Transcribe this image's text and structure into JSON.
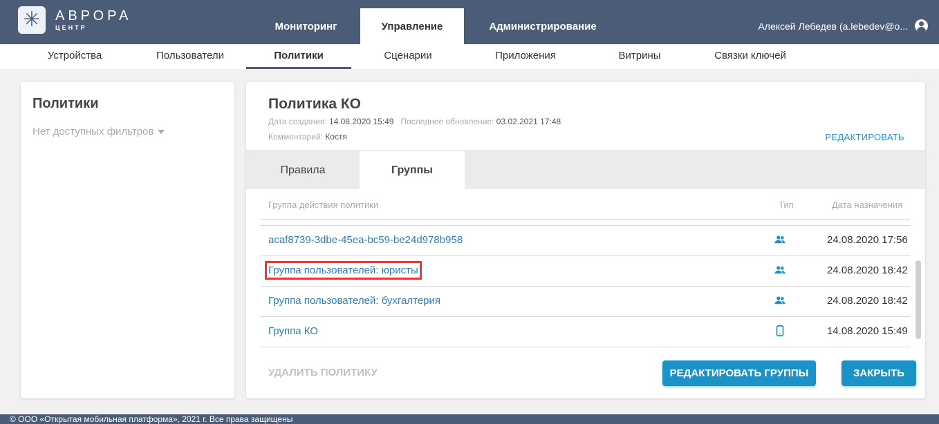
{
  "brand": {
    "title": "АВРОРА",
    "subtitle": "ЦЕНТР",
    "icon": "aurora-logo-icon"
  },
  "main_tabs": [
    {
      "label": "Мониторинг",
      "active": false
    },
    {
      "label": "Управление",
      "active": true
    },
    {
      "label": "Администрирование",
      "active": false
    }
  ],
  "user": {
    "name": "Алексей Лебедев (a.lebedev@o...",
    "icon": "account-circle-icon"
  },
  "sub_nav": [
    {
      "label": "Устройства",
      "active": false
    },
    {
      "label": "Пользователи",
      "active": false
    },
    {
      "label": "Политики",
      "active": true
    },
    {
      "label": "Сценарии",
      "active": false
    },
    {
      "label": "Приложения",
      "active": false
    },
    {
      "label": "Витрины",
      "active": false
    },
    {
      "label": "Связки ключей",
      "active": false
    }
  ],
  "left_panel": {
    "title": "Политики",
    "filter_label": "Нет доступных фильтров"
  },
  "policy": {
    "title": "Политика КО",
    "created_label": "Дата создания:",
    "created_value": "14.08.2020 15:49",
    "updated_label": "Последнее обновление:",
    "updated_value": "03.02.2021 17:48",
    "comment_label": "Комментарий:",
    "comment_value": "Костя",
    "edit_label": "РЕДАКТИРОВАТЬ"
  },
  "tabs": [
    {
      "label": "Правила",
      "active": false
    },
    {
      "label": "Группы",
      "active": true
    }
  ],
  "table": {
    "headers": {
      "name": "Группа действия политики",
      "type": "Тип",
      "date": "Дата назначения"
    },
    "rows": [
      {
        "name": "acaf8739-3dbe-45ea-bc59-be24d978b958",
        "type_icon": "user-group-icon",
        "date": "24.08.2020 17:56",
        "highlighted": false
      },
      {
        "name": "Группа пользователей: юристы",
        "type_icon": "user-group-icon",
        "date": "24.08.2020 18:42",
        "highlighted": true
      },
      {
        "name": "Группа пользователей: бухгалтерия",
        "type_icon": "user-group-icon",
        "date": "24.08.2020 18:42",
        "highlighted": false
      },
      {
        "name": "Группа КО",
        "type_icon": "mobile-device-icon",
        "date": "14.08.2020 15:49",
        "highlighted": false
      }
    ]
  },
  "actions": {
    "delete_label": "УДАЛИТЬ ПОЛИТИКУ",
    "edit_groups_label": "РЕДАКТИРОВАТЬ ГРУППЫ",
    "close_label": "ЗАКРЫТЬ"
  },
  "footer": {
    "text": "© ООО «Открытая мобильная платформа», 2021 г. Все права защищены"
  },
  "colors": {
    "header": "#4a5c78",
    "accent": "#1c93c8",
    "link": "#2b7fb8",
    "highlight": "#e53935"
  }
}
